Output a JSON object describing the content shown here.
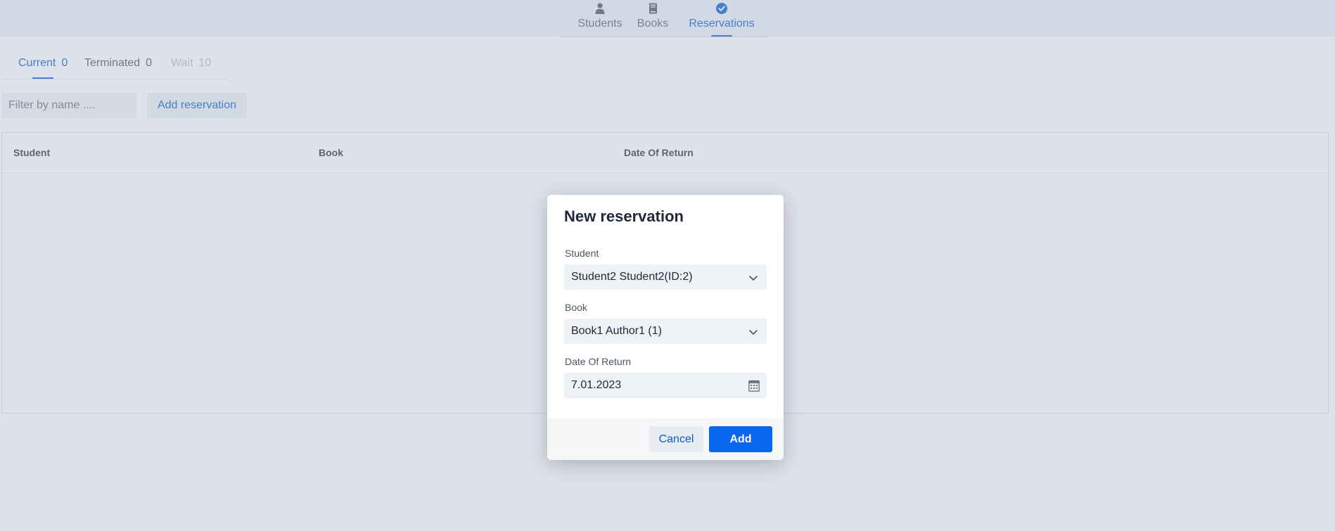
{
  "nav": {
    "items": [
      {
        "label": "Students",
        "icon": "person-icon"
      },
      {
        "label": "Books",
        "icon": "book-icon"
      },
      {
        "label": "Reservations",
        "icon": "check-circle-icon"
      }
    ],
    "active": "Reservations"
  },
  "subtabs": [
    {
      "label": "Current",
      "count": "0",
      "state": "active"
    },
    {
      "label": "Terminated",
      "count": "0",
      "state": "normal"
    },
    {
      "label": "Wait",
      "count": "10",
      "state": "disabled"
    }
  ],
  "filter": {
    "placeholder": "Filter by name ...."
  },
  "toolbar": {
    "add_reservation_label": "Add reservation"
  },
  "table": {
    "headers": [
      "Student",
      "Book",
      "Date Of Return"
    ]
  },
  "dialog": {
    "title": "New reservation",
    "student_label": "Student",
    "student_value": "Student2 Student2(ID:2)",
    "book_label": "Book",
    "book_value": "Book1 Author1 (1)",
    "date_label": "Date Of Return",
    "date_value": "7.01.2023",
    "cancel_label": "Cancel",
    "add_label": "Add"
  },
  "colors": {
    "accent": "#0a5dd6",
    "primary_button": "#0a66f0",
    "nav_background": "#edf1f7"
  }
}
